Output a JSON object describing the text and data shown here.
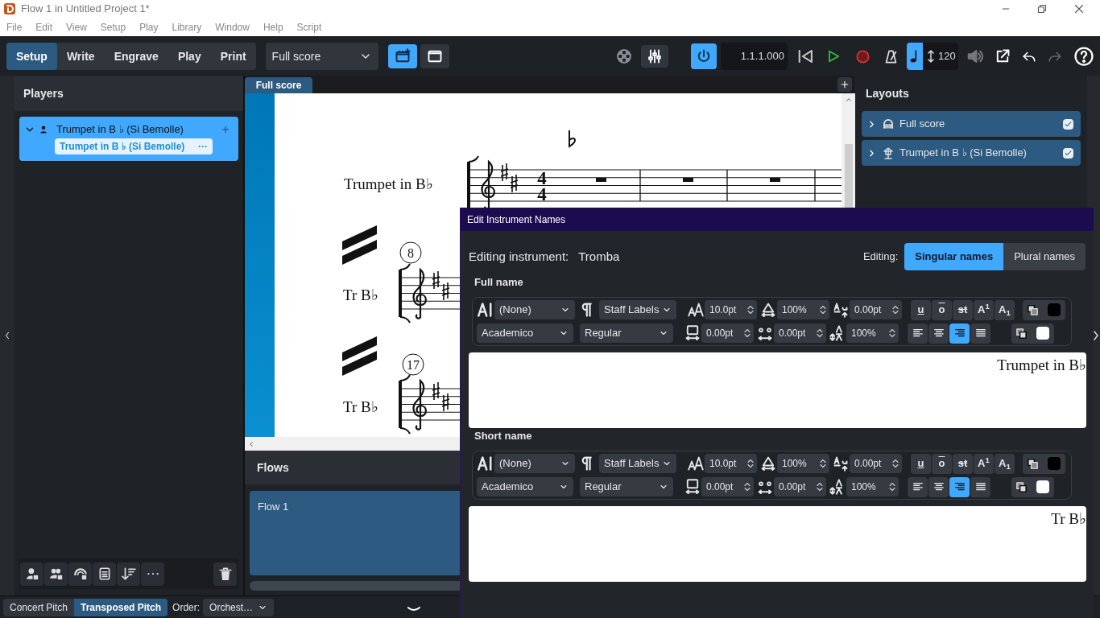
{
  "window": {
    "title": "Flow 1 in Untitled Project 1*"
  },
  "menu": [
    "File",
    "Edit",
    "View",
    "Setup",
    "Play",
    "Library",
    "Window",
    "Help",
    "Script"
  ],
  "modes": [
    {
      "label": "Setup",
      "selected": true
    },
    {
      "label": "Write",
      "selected": false
    },
    {
      "label": "Engrave",
      "selected": false
    },
    {
      "label": "Play",
      "selected": false
    },
    {
      "label": "Print",
      "selected": false
    }
  ],
  "layout_select": {
    "value": "Full score"
  },
  "view_buttons": [
    {
      "kind": "gallery",
      "selected": true
    },
    {
      "kind": "page",
      "selected": false
    }
  ],
  "transport": {
    "mixer_open": true,
    "activated": true,
    "time": "1.1.1.000",
    "tempo": "120",
    "redo_disabled": true
  },
  "players": {
    "title": "Players",
    "items": [
      {
        "name": "Trumpet in B ♭ (Si Bemolle)",
        "selected": true,
        "expanded": true,
        "instruments": [
          {
            "name": "Trumpet in B ♭ (Si Bemolle)",
            "more": "···"
          }
        ]
      }
    ]
  },
  "score": {
    "tab": "Full score",
    "instrument_full": "Trumpet in B♭",
    "short_labels": [
      "Tr B♭",
      "Tr B♭"
    ],
    "time_signature": [
      "4",
      "4"
    ],
    "bar_numbers": [
      "8",
      "17"
    ]
  },
  "flows": {
    "title": "Flows",
    "items": [
      {
        "name": "Flow 1",
        "selected": true
      }
    ]
  },
  "layouts": {
    "title": "Layouts",
    "items": [
      {
        "kind": "full",
        "name": "Full score",
        "checked": true
      },
      {
        "kind": "part",
        "name": "Trumpet in B ♭ (Si Bemolle)",
        "checked": true
      }
    ]
  },
  "status_bar": {
    "pitch": [
      {
        "label": "Concert Pitch",
        "selected": false
      },
      {
        "label": "Transposed Pitch",
        "selected": true
      }
    ],
    "order_label": "Order:",
    "order_value": "Orchest…"
  },
  "dialog": {
    "title": "Edit Instrument Names",
    "instrument_label": "Editing instrument:",
    "instrument": "Tromba",
    "editing_label": "Editing:",
    "editing": [
      {
        "label": "Singular names",
        "selected": true
      },
      {
        "label": "Plural names",
        "selected": false
      }
    ],
    "sections": [
      {
        "title": "Full name",
        "text": "Trumpet in B♭",
        "char_style": "(None)",
        "para_style": "Staff Labels",
        "font": "Academico",
        "font_style": "Regular",
        "size": "10.0pt",
        "width_scale": "100%",
        "baseline": "0.00pt",
        "tracking": "0.00pt",
        "spacing": "0.00pt",
        "height_scale": "100%",
        "format": [
          {
            "kind": "underline",
            "label": "u",
            "on": false
          },
          {
            "kind": "overline",
            "label": "o",
            "on": false
          },
          {
            "kind": "strike",
            "label": "st",
            "on": false
          },
          {
            "kind": "super",
            "label": "A$^{1}$",
            "on": false
          },
          {
            "kind": "sub",
            "label": "A$_{1}$",
            "on": false
          }
        ],
        "align": [
          {
            "kind": "left",
            "selected": false
          },
          {
            "kind": "center",
            "selected": false
          },
          {
            "kind": "right",
            "selected": true
          },
          {
            "kind": "justify",
            "selected": false
          }
        ],
        "swatches": [
          {
            "kind": "text",
            "color": "#000000"
          },
          {
            "kind": "background",
            "color": "#ffffff"
          }
        ]
      },
      {
        "title": "Short name",
        "text": "Tr B♭",
        "char_style": "(None)",
        "para_style": "Staff Labels",
        "font": "Academico",
        "font_style": "Regular",
        "size": "10.0pt",
        "width_scale": "100%",
        "baseline": "0.00pt",
        "tracking": "0.00pt",
        "spacing": "0.00pt",
        "height_scale": "100%",
        "format": [
          {
            "kind": "underline",
            "label": "u",
            "on": false
          },
          {
            "kind": "overline",
            "label": "o",
            "on": false
          },
          {
            "kind": "strike",
            "label": "st",
            "on": false
          },
          {
            "kind": "super",
            "label": "A$^{1}$",
            "on": false
          },
          {
            "kind": "sub",
            "label": "A$_{1}$",
            "on": false
          }
        ],
        "align": [
          {
            "kind": "left",
            "selected": false
          },
          {
            "kind": "center",
            "selected": false
          },
          {
            "kind": "right",
            "selected": true
          },
          {
            "kind": "justify",
            "selected": false
          }
        ],
        "swatches": [
          {
            "kind": "text",
            "color": "#000000"
          },
          {
            "kind": "background",
            "color": "#ffffff"
          }
        ]
      }
    ]
  }
}
